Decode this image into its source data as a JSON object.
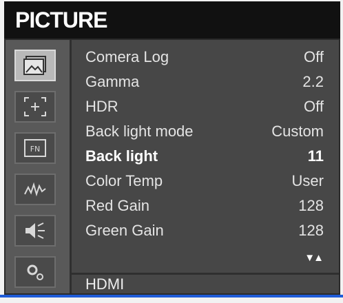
{
  "header": {
    "title": "PICTURE"
  },
  "sidebar": {
    "icons": [
      {
        "name": "picture-icon",
        "active": true
      },
      {
        "name": "marker-icon",
        "active": false
      },
      {
        "name": "function-key-icon",
        "active": false
      },
      {
        "name": "waveform-icon",
        "active": false
      },
      {
        "name": "audio-icon",
        "active": false
      },
      {
        "name": "system-settings-icon",
        "active": false
      }
    ]
  },
  "menu": {
    "items": [
      {
        "label": "Comera Log",
        "value": "Off",
        "selected": false
      },
      {
        "label": "Gamma",
        "value": "2.2",
        "selected": false
      },
      {
        "label": "HDR",
        "value": "Off",
        "selected": false
      },
      {
        "label": "Back light mode",
        "value": "Custom",
        "selected": false
      },
      {
        "label": "Back light",
        "value": "11",
        "selected": true
      },
      {
        "label": "Color Temp",
        "value": "User",
        "selected": false
      },
      {
        "label": "Red Gain",
        "value": "128",
        "selected": false
      },
      {
        "label": "Green Gain",
        "value": "128",
        "selected": false
      }
    ],
    "scroll_indicator": "▼▲"
  },
  "footer": {
    "source": "HDMI"
  },
  "colors": {
    "accent_line": "#1f5cd8",
    "panel": "#474747",
    "title_bar": "#111111"
  }
}
